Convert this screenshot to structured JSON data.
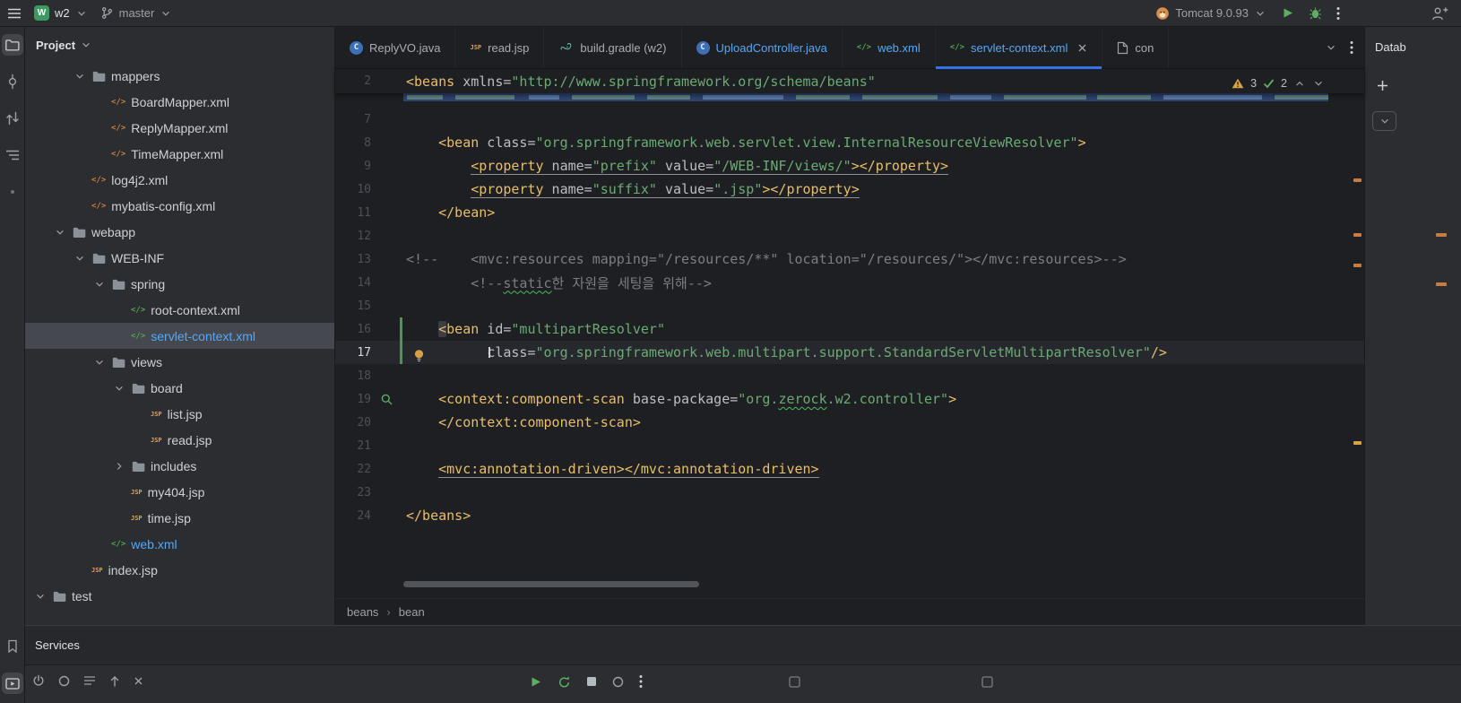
{
  "colors": {
    "accent_blue": "#3574F0",
    "modified_file_blue": "#56A8F5",
    "xml_tag": "#E8BF6A",
    "xml_string": "#6AAB73",
    "xml_comment": "#7A7E85",
    "xml_attribute": "#BCBEC4",
    "warning_stripe": "#C77D41",
    "vcs_added_green": "#549159"
  },
  "titlebar": {
    "project_badge": "W",
    "project_name": "w2",
    "branch": "master",
    "run_config": "Tomcat 9.0.93"
  },
  "left_strip": {
    "top": [
      "project-icon",
      "commit-icon",
      "pull-requests-icon",
      "structure-icon",
      "notifications-dot-icon"
    ],
    "bottom": [
      "bookmarks-icon",
      "services-icon"
    ]
  },
  "project_panel": {
    "title": "Project",
    "tree": [
      {
        "label": "mappers",
        "type": "folder",
        "level": 2,
        "expanded": true
      },
      {
        "label": "BoardMapper.xml",
        "type": "xml",
        "level": 3
      },
      {
        "label": "ReplyMapper.xml",
        "type": "xml",
        "level": 3
      },
      {
        "label": "TimeMapper.xml",
        "type": "xml",
        "level": 3
      },
      {
        "label": "log4j2.xml",
        "type": "xml",
        "level": 2
      },
      {
        "label": "mybatis-config.xml",
        "type": "xml",
        "level": 2
      },
      {
        "label": "webapp",
        "type": "folder",
        "level": 1,
        "expanded": true
      },
      {
        "label": "WEB-INF",
        "type": "folder",
        "level": 2,
        "expanded": true
      },
      {
        "label": "spring",
        "type": "folder",
        "level": 3,
        "expanded": true
      },
      {
        "label": "root-context.xml",
        "type": "spring",
        "level": 4
      },
      {
        "label": "servlet-context.xml",
        "type": "spring",
        "level": 4,
        "selected": true,
        "modified": true
      },
      {
        "label": "views",
        "type": "folder",
        "level": 3,
        "expanded": true
      },
      {
        "label": "board",
        "type": "folder",
        "level": 4,
        "expanded": true
      },
      {
        "label": "list.jsp",
        "type": "jsp",
        "level": 5
      },
      {
        "label": "read.jsp",
        "type": "jsp",
        "level": 5
      },
      {
        "label": "includes",
        "type": "folder",
        "level": 4,
        "expanded": false
      },
      {
        "label": "my404.jsp",
        "type": "jsp",
        "level": 4
      },
      {
        "label": "time.jsp",
        "type": "jsp",
        "level": 4
      },
      {
        "label": "web.xml",
        "type": "spring",
        "level": 3,
        "modified": true
      },
      {
        "label": "index.jsp",
        "type": "jsp",
        "level": 2
      },
      {
        "label": "test",
        "type": "folder",
        "level": 0,
        "expanded": true
      }
    ]
  },
  "editor_tabs": [
    {
      "label": "ReplyVO.java",
      "icon": "java-class-icon"
    },
    {
      "label": "read.jsp",
      "icon": "jsp-icon"
    },
    {
      "label": "build.gradle (w2)",
      "icon": "gradle-icon"
    },
    {
      "label": "UploadController.java",
      "icon": "java-class-icon",
      "modified": true
    },
    {
      "label": "web.xml",
      "icon": "spring-config-icon",
      "modified": true
    },
    {
      "label": "servlet-context.xml",
      "icon": "spring-config-icon",
      "modified": true,
      "active": true
    },
    {
      "label": "con",
      "icon": "file-icon"
    }
  ],
  "tab_actions": [
    "hidden-tabs-chevron-icon",
    "tab-options-kebab-icon"
  ],
  "editor": {
    "inspections": {
      "warnings": "3",
      "typos": "2"
    },
    "sticky_line": {
      "n": "2",
      "segs": [
        [
          "<beans",
          "tag"
        ],
        [
          " xmlns=",
          "attr"
        ],
        [
          "\"http://www.springframework.org/schema/beans\"",
          "str"
        ]
      ]
    },
    "lines": [
      {
        "n": "7",
        "segs": []
      },
      {
        "n": "8",
        "segs": [
          [
            "    ",
            ""
          ],
          [
            "<bean",
            "tag"
          ],
          [
            " class=",
            "attr"
          ],
          [
            "\"org.springframework.web.servlet.view.InternalResourceViewResolver\"",
            "str"
          ],
          [
            ">",
            "tag"
          ]
        ]
      },
      {
        "n": "9",
        "segs": [
          [
            "        ",
            ""
          ],
          [
            "<property",
            "tag u"
          ],
          [
            " name=",
            "attr u"
          ],
          [
            "\"prefix\"",
            "str u"
          ],
          [
            " value=",
            "attr u"
          ],
          [
            "\"/WEB-INF/views/\"",
            "str u"
          ],
          [
            "></property>",
            "tag u"
          ]
        ]
      },
      {
        "n": "10",
        "segs": [
          [
            "        ",
            ""
          ],
          [
            "<property",
            "tag u"
          ],
          [
            " name=",
            "attr u"
          ],
          [
            "\"suffix\"",
            "str u"
          ],
          [
            " value=",
            "attr u"
          ],
          [
            "\".jsp\"",
            "str u"
          ],
          [
            "></property>",
            "tag u"
          ]
        ]
      },
      {
        "n": "11",
        "segs": [
          [
            "    ",
            ""
          ],
          [
            "</bean>",
            "tag"
          ]
        ]
      },
      {
        "n": "12",
        "segs": []
      },
      {
        "n": "13",
        "segs": [
          [
            "<!--    <mvc:resources mapping=\"/resources/**\" location=\"/resources/\"></mvc:resources>-->",
            "com"
          ]
        ]
      },
      {
        "n": "14",
        "segs": [
          [
            "        ",
            ""
          ],
          [
            "<!--",
            "com"
          ],
          [
            "static",
            "com wavy"
          ],
          [
            "한 자원을 세팅을 위해-->",
            "com"
          ]
        ]
      },
      {
        "n": "15",
        "segs": []
      },
      {
        "n": "16",
        "changed": true,
        "segs": [
          [
            "    ",
            ""
          ],
          [
            "<",
            "tag match"
          ],
          [
            "bean",
            "tag"
          ],
          [
            " id=",
            "attr"
          ],
          [
            "\"multipartResolver\"",
            "str"
          ]
        ]
      },
      {
        "n": "17",
        "current": true,
        "changed": true,
        "bulb": true,
        "caret": 92,
        "segs": [
          [
            "          ",
            ""
          ],
          [
            "class=",
            "attr"
          ],
          [
            "\"org.springframework.web.multipart.support.StandardServletMultipartResolver\"",
            "str"
          ],
          [
            "/>",
            "tag"
          ]
        ]
      },
      {
        "n": "18",
        "segs": []
      },
      {
        "n": "19",
        "gutter": "spring-bean-icon",
        "segs": [
          [
            "    ",
            ""
          ],
          [
            "<context:component-scan",
            "tag"
          ],
          [
            " base-package=",
            "attr"
          ],
          [
            "\"org.",
            "str"
          ],
          [
            "zerock",
            "str wavy"
          ],
          [
            ".w2.controller\"",
            "str"
          ],
          [
            ">",
            "tag"
          ]
        ]
      },
      {
        "n": "20",
        "segs": [
          [
            "    ",
            ""
          ],
          [
            "</context:component-scan>",
            "tag"
          ]
        ]
      },
      {
        "n": "21",
        "segs": []
      },
      {
        "n": "22",
        "segs": [
          [
            "    ",
            ""
          ],
          [
            "<mvc:annotation-driven></mvc:annotation-driven>",
            "tag u"
          ]
        ]
      },
      {
        "n": "23",
        "segs": []
      },
      {
        "n": "24",
        "segs": [
          [
            "</beans>",
            "tag"
          ]
        ]
      }
    ],
    "scrollbar_marks": [
      122,
      183,
      217,
      415
    ],
    "breadcrumbs": [
      "beans",
      "bean"
    ]
  },
  "database_panel": {
    "title": "Datab",
    "stripe_marks": [
      230,
      285
    ]
  },
  "services_panel": {
    "title": "Services"
  },
  "bottom_bar": {
    "left_icons": [
      "power-icon",
      "suspend-icon",
      "list-icon",
      "collapse-icon",
      "close-icon"
    ],
    "run_icons": [
      "run-icon",
      "rerun-icon",
      "stop-icon",
      "suspend-icon",
      "kebab-icon"
    ],
    "checkbox_positions": [
      852,
      1067
    ]
  }
}
